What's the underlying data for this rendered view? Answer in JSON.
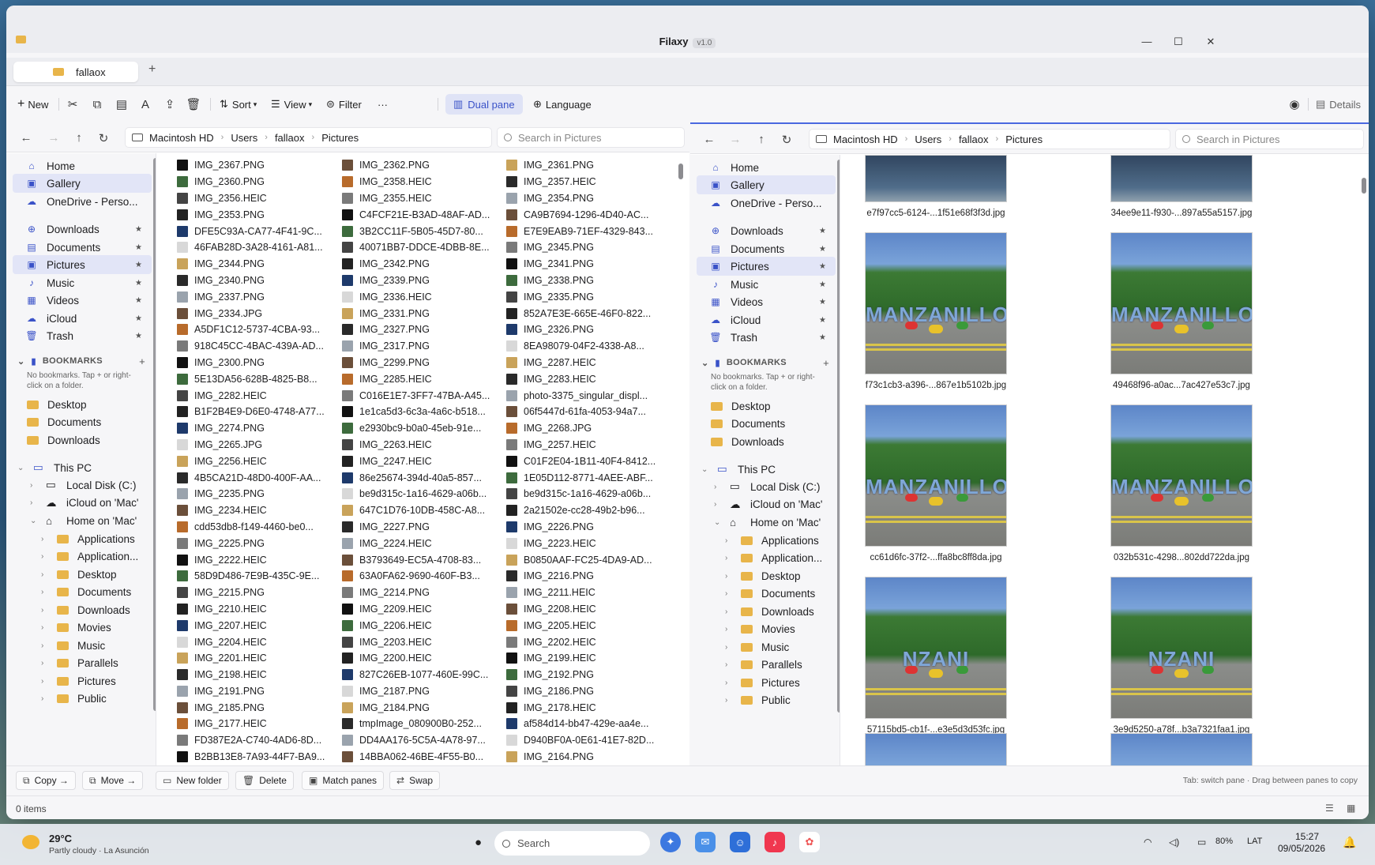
{
  "window": {
    "title": "Filaxy",
    "version": "v1.0",
    "minimize": "—",
    "maximize": "☐",
    "close": "✕"
  },
  "tabs": [
    {
      "label": "fallaox"
    }
  ],
  "tab_add": "+",
  "toolbar": {
    "new": "New",
    "sort": "Sort",
    "view": "View",
    "filter": "Filter",
    "more": "···",
    "dual_pane": "Dual pane",
    "language": "Language",
    "details": "Details"
  },
  "left_pane": {
    "breadcrumb": [
      "Macintosh HD",
      "Users",
      "fallaox",
      "Pictures"
    ],
    "search_placeholder": "Search in Pictures",
    "files": [
      [
        "IMG_2367.PNG",
        "IMG_2360.PNG",
        "IMG_2356.HEIC",
        "IMG_2353.PNG",
        "DFE5C93A-CA77-4F41-9C...",
        "46FAB28D-3A28-4161-A81...",
        "IMG_2344.PNG",
        "IMG_2340.PNG",
        "IMG_2337.PNG",
        "IMG_2334.JPG",
        "A5DF1C12-5737-4CBA-93...",
        "918C45CC-4BAC-439A-AD...",
        "IMG_2300.PNG",
        "5E13DA56-628B-4825-B8...",
        "IMG_2282.HEIC",
        "B1F2B4E9-D6E0-4748-A77...",
        "IMG_2274.PNG",
        "IMG_2265.JPG",
        "IMG_2256.HEIC",
        "4B5CA21D-48D0-400F-AA...",
        "IMG_2235.PNG",
        "IMG_2234.HEIC",
        "cdd53db8-f149-4460-be0...",
        "IMG_2225.PNG",
        "IMG_2222.HEIC",
        "58D9D486-7E9B-435C-9E...",
        "IMG_2215.PNG",
        "IMG_2210.HEIC",
        "IMG_2207.HEIC",
        "IMG_2204.HEIC",
        "IMG_2201.HEIC",
        "IMG_2198.HEIC",
        "IMG_2191.PNG",
        "IMG_2185.PNG",
        "IMG_2177.HEIC",
        "FD387E2A-C740-4AD6-8D...",
        "B2BB13E8-7A93-44F7-BA9..."
      ],
      [
        "IMG_2362.PNG",
        "IMG_2358.HEIC",
        "IMG_2355.HEIC",
        "C4FCF21E-B3AD-48AF-AD...",
        "3B2CC11F-5B05-45D7-80...",
        "40071BB7-DDCE-4DBB-8E...",
        "IMG_2342.PNG",
        "IMG_2339.PNG",
        "IMG_2336.HEIC",
        "IMG_2331.PNG",
        "IMG_2327.PNG",
        "IMG_2317.PNG",
        "IMG_2299.PNG",
        "IMG_2285.HEIC",
        "C016E1E7-3FF7-47BA-A45...",
        "1e1ca5d3-6c3a-4a6c-b518...",
        "e2930bc9-b0a0-45eb-91e...",
        "IMG_2263.HEIC",
        "IMG_2247.HEIC",
        "86e25674-394d-40a5-857...",
        "be9d315c-1a16-4629-a06b...",
        "647C1D76-10DB-458C-A8...",
        "IMG_2227.PNG",
        "IMG_2224.HEIC",
        "B3793649-EC5A-4708-83...",
        "63A0FA62-9690-460F-B3...",
        "IMG_2214.PNG",
        "IMG_2209.HEIC",
        "IMG_2206.HEIC",
        "IMG_2203.HEIC",
        "IMG_2200.HEIC",
        "827C26EB-1077-460E-99C...",
        "IMG_2187.PNG",
        "IMG_2184.PNG",
        "tmpImage_080900B0-252...",
        "DD4AA176-5C5A-4A78-97...",
        "14BBA062-46BE-4F55-B0..."
      ],
      [
        "IMG_2361.PNG",
        "IMG_2357.HEIC",
        "IMG_2354.PNG",
        "CA9B7694-1296-4D40-AC...",
        "E7E9EAB9-71EF-4329-843...",
        "IMG_2345.PNG",
        "IMG_2341.PNG",
        "IMG_2338.PNG",
        "IMG_2335.PNG",
        "852A7E3E-665E-46F0-822...",
        "IMG_2326.PNG",
        "8EA98079-04F2-4338-A8...",
        "IMG_2287.HEIC",
        "IMG_2283.HEIC",
        "photo-3375_singular_displ...",
        "06f5447d-61fa-4053-94a7...",
        "IMG_2268.JPG",
        "IMG_2257.HEIC",
        "C01F2E04-1B11-40F4-8412...",
        "1E05D112-8771-4AEE-ABF...",
        "be9d315c-1a16-4629-a06b...",
        "2a21502e-cc28-49b2-b96...",
        "IMG_2226.PNG",
        "IMG_2223.HEIC",
        "B0850AAF-FC25-4DA9-AD...",
        "IMG_2216.PNG",
        "IMG_2211.HEIC",
        "IMG_2208.HEIC",
        "IMG_2205.HEIC",
        "IMG_2202.HEIC",
        "IMG_2199.HEIC",
        "IMG_2192.PNG",
        "IMG_2186.PNG",
        "IMG_2178.HEIC",
        "af584d14-bb47-429e-aa4e...",
        "D940BF0A-0E61-41E7-82D...",
        "IMG_2164.PNG"
      ]
    ]
  },
  "right_pane": {
    "breadcrumb": [
      "Macintosh HD",
      "Users",
      "fallaox",
      "Pictures"
    ],
    "search_placeholder": "Search in Pictures",
    "gallery": [
      {
        "name": "e7f97cc5-6124-...1f51e68f3f3d.jpg",
        "sign": ""
      },
      {
        "name": "34ee9e11-f930-...897a55a5157.jpg",
        "sign": ""
      },
      {
        "name": "f73c1cb3-a396-...867e1b5102b.jpg",
        "sign": "MANZANILLO"
      },
      {
        "name": "49468f96-a0ac...7ac427e53c7.jpg",
        "sign": "MANZANILLO"
      },
      {
        "name": "cc61d6fc-37f2-...ffa8bc8ff8da.jpg",
        "sign": "MANZANILLO"
      },
      {
        "name": "032b531c-4298...802dd722da.jpg",
        "sign": "MANZANILLO"
      },
      {
        "name": "57115bd5-cb1f-...e3e5d3d53fc.jpg",
        "sign": "NZANI"
      },
      {
        "name": "3e9d5250-a78f...b3a7321faa1.jpg",
        "sign": "NZANI"
      }
    ]
  },
  "sidebar": {
    "items": [
      {
        "label": "Home",
        "icon": "home-icon",
        "glyph": "⌂"
      },
      {
        "label": "Gallery",
        "icon": "gallery-icon",
        "glyph": "▣"
      },
      {
        "label": "OneDrive - Perso...",
        "icon": "cloud-icon",
        "glyph": "☁"
      },
      {
        "label": "Downloads",
        "icon": "download-icon",
        "glyph": "⊕"
      },
      {
        "label": "Documents",
        "icon": "document-icon",
        "glyph": "▤"
      },
      {
        "label": "Pictures",
        "icon": "picture-icon",
        "glyph": "▣"
      },
      {
        "label": "Music",
        "icon": "music-icon",
        "glyph": "♪"
      },
      {
        "label": "Videos",
        "icon": "video-icon",
        "glyph": "▦"
      },
      {
        "label": "iCloud",
        "icon": "cloud-icon",
        "glyph": "☁"
      },
      {
        "label": "Trash",
        "icon": "trash-icon",
        "glyph": "🗑"
      }
    ],
    "bookmarks_header": "BOOKMARKS",
    "bookmarks_note": "No bookmarks. Tap + or right-click on a folder.",
    "bookmarks": [
      "Desktop",
      "Documents",
      "Downloads"
    ],
    "this_pc": "This PC",
    "drives": [
      "Local Disk (C:)",
      "iCloud on 'Mac'",
      "Home on 'Mac'"
    ],
    "home_folders": [
      "Applications",
      "Application...",
      "Desktop",
      "Documents",
      "Downloads",
      "Movies",
      "Music",
      "Parallels",
      "Pictures",
      "Public"
    ]
  },
  "actions": {
    "copy": "Copy →",
    "move": "Move →",
    "new_folder": "New folder",
    "delete": "Delete",
    "match_panes": "Match panes",
    "swap": "Swap",
    "hint": "Tab: switch pane · Drag between panes to copy"
  },
  "status": {
    "items": "0 items"
  },
  "taskbar": {
    "temp": "29°C",
    "weather": "Partly cloudy · La Asunción",
    "search": "Search",
    "battery": "80%",
    "lang": "LAT",
    "time": "15:27",
    "date": "09/05/2026"
  },
  "colors": {
    "accent": "#3a52c8",
    "folder": "#e8b54a",
    "selected": "#e2e5f7"
  }
}
